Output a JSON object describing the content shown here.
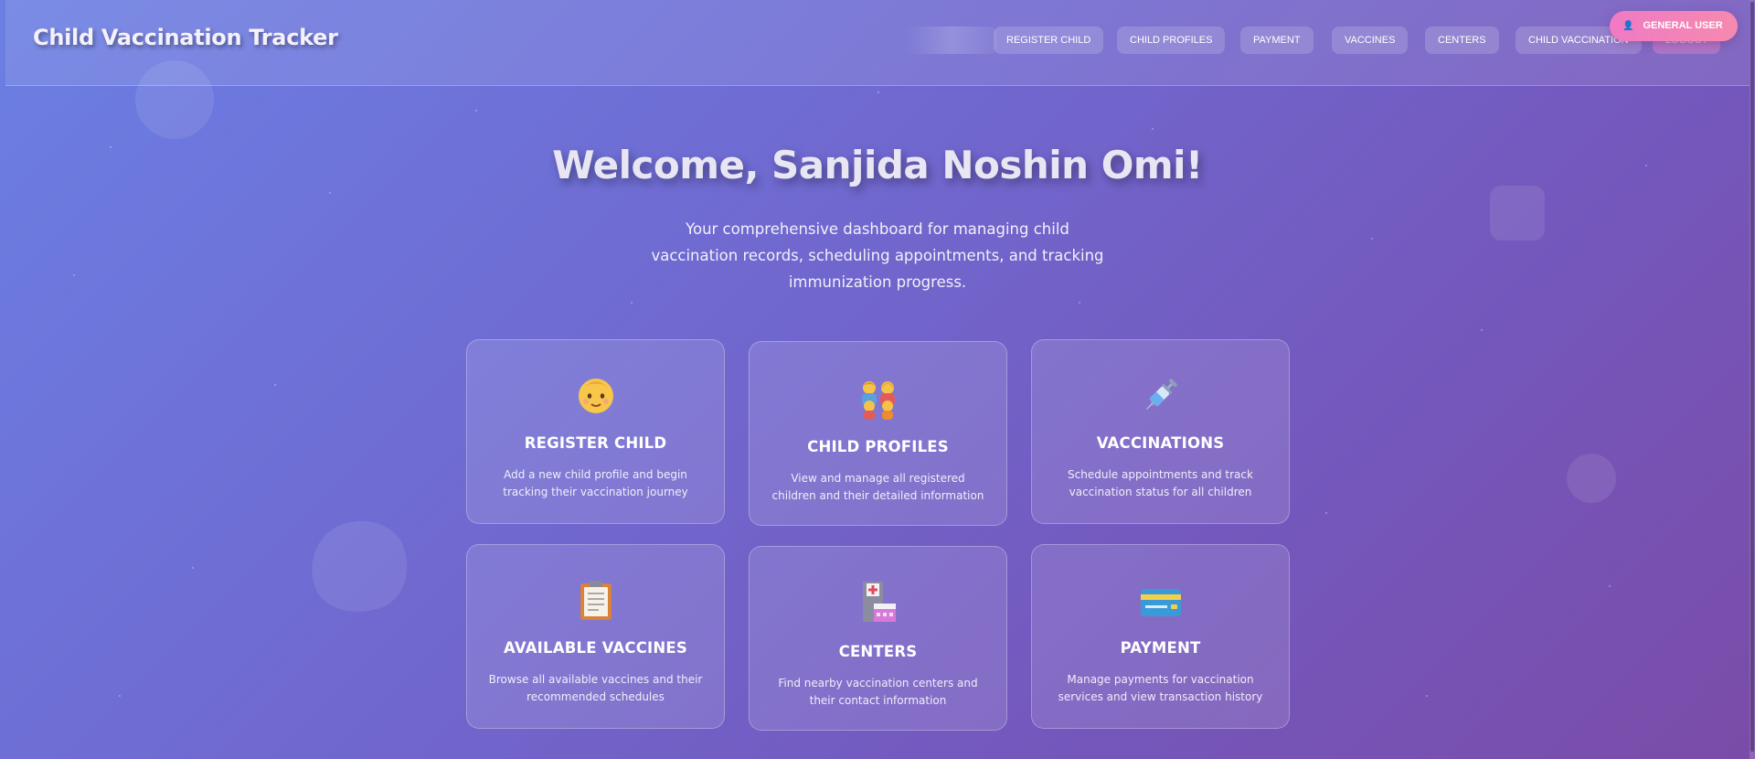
{
  "app": {
    "brand": "Child Vaccination Tracker",
    "user_role": "General User",
    "user_icon": "user-icon"
  },
  "nav": [
    {
      "label": "Register Child"
    },
    {
      "label": "Child Profiles"
    },
    {
      "label": "Payment"
    },
    {
      "label": "Vaccines"
    },
    {
      "label": "Centers"
    },
    {
      "label": "Child Vaccination"
    },
    {
      "label": "Logout"
    }
  ],
  "hero": {
    "welcome": "Welcome, Sanjida Noshin Omi!",
    "subtitle": "Your comprehensive dashboard for managing child vaccination records, scheduling appointments, and tracking immunization progress."
  },
  "cards": [
    {
      "title": "Register Child",
      "description": "Add a new child profile and begin tracking their vaccination journey",
      "icon": "baby-icon"
    },
    {
      "title": "Child Profiles",
      "description": "View and manage all registered children and their detailed information",
      "icon": "family-icon"
    },
    {
      "title": "Vaccinations",
      "description": "Schedule appointments and track vaccination status for all children",
      "icon": "syringe-icon"
    },
    {
      "title": "Available Vaccines",
      "description": "Browse all available vaccines and their recommended schedules",
      "icon": "clipboard-icon"
    },
    {
      "title": "Centers",
      "description": "Find nearby vaccination centers and their contact information",
      "icon": "hospital-icon"
    },
    {
      "title": "Payment",
      "description": "Manage payments for vaccination services and view transaction history",
      "icon": "credit-card-icon"
    }
  ],
  "colors": {
    "background_start": "#6b7fe3",
    "background_end": "#7a4ca8",
    "badge": "#f07ac4"
  }
}
